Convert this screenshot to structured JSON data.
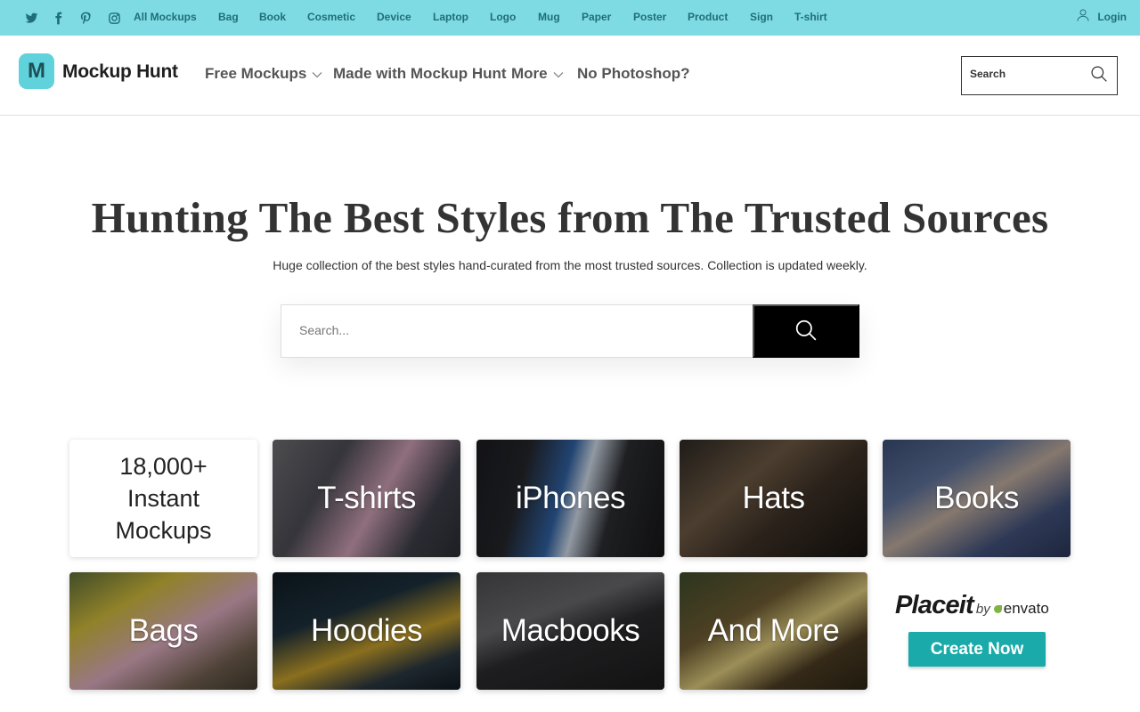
{
  "topbar": {
    "social": [
      {
        "name": "twitter-icon"
      },
      {
        "name": "facebook-icon"
      },
      {
        "name": "pinterest-icon"
      },
      {
        "name": "instagram-icon"
      }
    ],
    "links": [
      "All Mockups",
      "Bag",
      "Book",
      "Cosmetic",
      "Device",
      "Laptop",
      "Logo",
      "Mug",
      "Paper",
      "Poster",
      "Product",
      "Sign",
      "T-shirt"
    ],
    "login_label": "Login",
    "bg_color": "#7fdbe3"
  },
  "header": {
    "logo_mark": "M",
    "logo_text": "Mockup Hunt",
    "nav": [
      {
        "label": "Free Mockups",
        "has_dropdown": true
      },
      {
        "label": "Made with Mockup Hunt",
        "has_dropdown": false
      },
      {
        "label": "More",
        "has_dropdown": true
      },
      {
        "label": "No Photoshop?",
        "has_dropdown": false
      }
    ],
    "search_placeholder": "Search"
  },
  "hero": {
    "title": "Hunting The Best Styles from The Trusted Sources",
    "subtitle": "Huge collection of the best styles hand-curated from the most trusted sources. Collection is updated weekly.",
    "search_placeholder": "Search..."
  },
  "tiles": {
    "intro": [
      "18,000+",
      "Instant",
      "Mockups"
    ],
    "categories": [
      "T-shirts",
      "iPhones",
      "Hats",
      "Books",
      "Bags",
      "Hoodies",
      "Macbooks",
      "And More"
    ]
  },
  "placeit": {
    "word": "Placeit",
    "by": "by",
    "brand": "envato",
    "button_label": "Create Now",
    "button_color": "#1aaaa9"
  }
}
